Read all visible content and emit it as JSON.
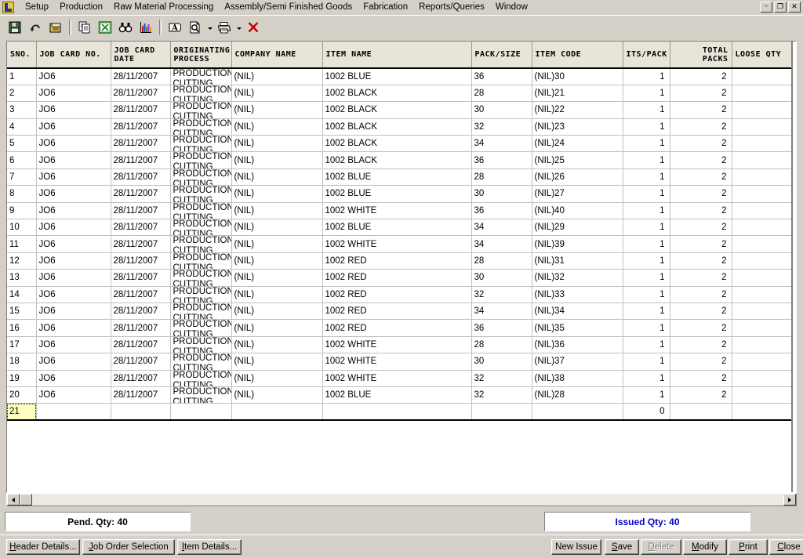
{
  "window": {
    "app_icon": "app-logo-icon",
    "controls": [
      {
        "name": "minimize-button",
        "glyph": "–"
      },
      {
        "name": "restore-button",
        "glyph": "❐"
      },
      {
        "name": "close-button",
        "glyph": "✕"
      }
    ]
  },
  "menubar": {
    "items": [
      {
        "label": "Setup"
      },
      {
        "label": "Production"
      },
      {
        "label": "Raw Material Processing"
      },
      {
        "label": "Assembly/Semi Finished Goods"
      },
      {
        "label": "Fabrication"
      },
      {
        "label": "Reports/Queries"
      },
      {
        "label": "Window"
      }
    ]
  },
  "toolbar": {
    "buttons": [
      {
        "name": "save-icon",
        "title": "Save"
      },
      {
        "name": "undo-icon",
        "title": "Undo"
      },
      {
        "name": "open-folder-icon",
        "title": "Open"
      },
      {
        "name": "copy-icon",
        "title": "Copy"
      },
      {
        "name": "export-excel-icon",
        "title": "Export to Excel"
      },
      {
        "name": "find-binoculars-icon",
        "title": "Find"
      },
      {
        "name": "chart-icon",
        "title": "Chart"
      },
      {
        "name": "text-format-icon",
        "title": "Font"
      },
      {
        "name": "print-preview-icon",
        "title": "Print Preview"
      },
      {
        "name": "printer-icon",
        "title": "Print"
      },
      {
        "name": "close-red-x-icon",
        "title": "Close"
      }
    ]
  },
  "grid": {
    "columns": [
      {
        "key": "sno",
        "label": "SNO.",
        "align": "left"
      },
      {
        "key": "job_card_no",
        "label": "JOB CARD NO.",
        "align": "left"
      },
      {
        "key": "job_card_date",
        "label": "JOB CARD DATE",
        "align": "left"
      },
      {
        "key": "originating_process",
        "label": "ORIGINATING PROCESS",
        "align": "left"
      },
      {
        "key": "company_name",
        "label": "COMPANY NAME",
        "align": "left"
      },
      {
        "key": "item_name",
        "label": "ITEM NAME",
        "align": "left"
      },
      {
        "key": "pack_size",
        "label": "PACK/SIZE",
        "align": "left"
      },
      {
        "key": "item_code",
        "label": "ITEM CODE",
        "align": "left"
      },
      {
        "key": "its_pack",
        "label": "ITS/PACK",
        "align": "right"
      },
      {
        "key": "total_packs",
        "label": "TOTAL PACKS",
        "align": "right"
      },
      {
        "key": "loose_qty",
        "label": "LOOSE QTY",
        "align": "left"
      }
    ],
    "rows": [
      {
        "sno": "1",
        "job_card_no": "JO6",
        "job_card_date": "28/11/2007",
        "originating_process": "PRODUCTION CUTTING",
        "company_name": "(NIL)",
        "item_name": "1002 BLUE",
        "pack_size": "36",
        "item_code": "(NIL)30",
        "its_pack": "1",
        "total_packs": "2",
        "loose_qty": ""
      },
      {
        "sno": "2",
        "job_card_no": "JO6",
        "job_card_date": "28/11/2007",
        "originating_process": "PRODUCTION CUTTING",
        "company_name": "(NIL)",
        "item_name": "1002 BLACK",
        "pack_size": "28",
        "item_code": "(NIL)21",
        "its_pack": "1",
        "total_packs": "2",
        "loose_qty": ""
      },
      {
        "sno": "3",
        "job_card_no": "JO6",
        "job_card_date": "28/11/2007",
        "originating_process": "PRODUCTION CUTTING",
        "company_name": "(NIL)",
        "item_name": "1002 BLACK",
        "pack_size": "30",
        "item_code": "(NIL)22",
        "its_pack": "1",
        "total_packs": "2",
        "loose_qty": ""
      },
      {
        "sno": "4",
        "job_card_no": "JO6",
        "job_card_date": "28/11/2007",
        "originating_process": "PRODUCTION CUTTING",
        "company_name": "(NIL)",
        "item_name": "1002 BLACK",
        "pack_size": "32",
        "item_code": "(NIL)23",
        "its_pack": "1",
        "total_packs": "2",
        "loose_qty": ""
      },
      {
        "sno": "5",
        "job_card_no": "JO6",
        "job_card_date": "28/11/2007",
        "originating_process": "PRODUCTION CUTTING",
        "company_name": "(NIL)",
        "item_name": "1002 BLACK",
        "pack_size": "34",
        "item_code": "(NIL)24",
        "its_pack": "1",
        "total_packs": "2",
        "loose_qty": ""
      },
      {
        "sno": "6",
        "job_card_no": "JO6",
        "job_card_date": "28/11/2007",
        "originating_process": "PRODUCTION CUTTING",
        "company_name": "(NIL)",
        "item_name": "1002 BLACK",
        "pack_size": "36",
        "item_code": "(NIL)25",
        "its_pack": "1",
        "total_packs": "2",
        "loose_qty": ""
      },
      {
        "sno": "7",
        "job_card_no": "JO6",
        "job_card_date": "28/11/2007",
        "originating_process": "PRODUCTION CUTTING",
        "company_name": "(NIL)",
        "item_name": "1002 BLUE",
        "pack_size": "28",
        "item_code": "(NIL)26",
        "its_pack": "1",
        "total_packs": "2",
        "loose_qty": ""
      },
      {
        "sno": "8",
        "job_card_no": "JO6",
        "job_card_date": "28/11/2007",
        "originating_process": "PRODUCTION CUTTING",
        "company_name": "(NIL)",
        "item_name": "1002 BLUE",
        "pack_size": "30",
        "item_code": "(NIL)27",
        "its_pack": "1",
        "total_packs": "2",
        "loose_qty": ""
      },
      {
        "sno": "9",
        "job_card_no": "JO6",
        "job_card_date": "28/11/2007",
        "originating_process": "PRODUCTION CUTTING",
        "company_name": "(NIL)",
        "item_name": "1002 WHITE",
        "pack_size": "36",
        "item_code": "(NIL)40",
        "its_pack": "1",
        "total_packs": "2",
        "loose_qty": ""
      },
      {
        "sno": "10",
        "job_card_no": "JO6",
        "job_card_date": "28/11/2007",
        "originating_process": "PRODUCTION CUTTING",
        "company_name": "(NIL)",
        "item_name": "1002 BLUE",
        "pack_size": "34",
        "item_code": "(NIL)29",
        "its_pack": "1",
        "total_packs": "2",
        "loose_qty": ""
      },
      {
        "sno": "11",
        "job_card_no": "JO6",
        "job_card_date": "28/11/2007",
        "originating_process": "PRODUCTION CUTTING",
        "company_name": "(NIL)",
        "item_name": "1002 WHITE",
        "pack_size": "34",
        "item_code": "(NIL)39",
        "its_pack": "1",
        "total_packs": "2",
        "loose_qty": ""
      },
      {
        "sno": "12",
        "job_card_no": "JO6",
        "job_card_date": "28/11/2007",
        "originating_process": "PRODUCTION CUTTING",
        "company_name": "(NIL)",
        "item_name": "1002 RED",
        "pack_size": "28",
        "item_code": "(NIL)31",
        "its_pack": "1",
        "total_packs": "2",
        "loose_qty": ""
      },
      {
        "sno": "13",
        "job_card_no": "JO6",
        "job_card_date": "28/11/2007",
        "originating_process": "PRODUCTION CUTTING",
        "company_name": "(NIL)",
        "item_name": "1002 RED",
        "pack_size": "30",
        "item_code": "(NIL)32",
        "its_pack": "1",
        "total_packs": "2",
        "loose_qty": ""
      },
      {
        "sno": "14",
        "job_card_no": "JO6",
        "job_card_date": "28/11/2007",
        "originating_process": "PRODUCTION CUTTING",
        "company_name": "(NIL)",
        "item_name": "1002 RED",
        "pack_size": "32",
        "item_code": "(NIL)33",
        "its_pack": "1",
        "total_packs": "2",
        "loose_qty": ""
      },
      {
        "sno": "15",
        "job_card_no": "JO6",
        "job_card_date": "28/11/2007",
        "originating_process": "PRODUCTION CUTTING",
        "company_name": "(NIL)",
        "item_name": "1002 RED",
        "pack_size": "34",
        "item_code": "(NIL)34",
        "its_pack": "1",
        "total_packs": "2",
        "loose_qty": ""
      },
      {
        "sno": "16",
        "job_card_no": "JO6",
        "job_card_date": "28/11/2007",
        "originating_process": "PRODUCTION CUTTING",
        "company_name": "(NIL)",
        "item_name": "1002 RED",
        "pack_size": "36",
        "item_code": "(NIL)35",
        "its_pack": "1",
        "total_packs": "2",
        "loose_qty": ""
      },
      {
        "sno": "17",
        "job_card_no": "JO6",
        "job_card_date": "28/11/2007",
        "originating_process": "PRODUCTION CUTTING",
        "company_name": "(NIL)",
        "item_name": "1002 WHITE",
        "pack_size": "28",
        "item_code": "(NIL)36",
        "its_pack": "1",
        "total_packs": "2",
        "loose_qty": ""
      },
      {
        "sno": "18",
        "job_card_no": "JO6",
        "job_card_date": "28/11/2007",
        "originating_process": "PRODUCTION CUTTING",
        "company_name": "(NIL)",
        "item_name": "1002 WHITE",
        "pack_size": "30",
        "item_code": "(NIL)37",
        "its_pack": "1",
        "total_packs": "2",
        "loose_qty": ""
      },
      {
        "sno": "19",
        "job_card_no": "JO6",
        "job_card_date": "28/11/2007",
        "originating_process": "PRODUCTION CUTTING",
        "company_name": "(NIL)",
        "item_name": "1002 WHITE",
        "pack_size": "32",
        "item_code": "(NIL)38",
        "its_pack": "1",
        "total_packs": "2",
        "loose_qty": ""
      },
      {
        "sno": "20",
        "job_card_no": "JO6",
        "job_card_date": "28/11/2007",
        "originating_process": "PRODUCTION CUTTING",
        "company_name": "(NIL)",
        "item_name": "1002 BLUE",
        "pack_size": "32",
        "item_code": "(NIL)28",
        "its_pack": "1",
        "total_packs": "2",
        "loose_qty": ""
      },
      {
        "sno": "21",
        "job_card_no": "",
        "job_card_date": "",
        "originating_process": "",
        "company_name": "",
        "item_name": "",
        "pack_size": "",
        "item_code": "",
        "its_pack": "0",
        "total_packs": "",
        "loose_qty": "",
        "focused": true
      }
    ]
  },
  "status": {
    "pending_qty": "Pend. Qty: 40",
    "issued_qty": "Issued Qty: 40",
    "issued_color": "#0000cc"
  },
  "buttons": {
    "left": [
      {
        "name": "header-details-button",
        "accel": "H",
        "rest": "eader Details...",
        "enabled": true
      },
      {
        "name": "job-order-selection-button",
        "accel": "J",
        "rest": "ob Order Selection",
        "enabled": true
      },
      {
        "name": "item-details-button",
        "accel": "I",
        "rest": "tem Details...",
        "enabled": true
      }
    ],
    "right": [
      {
        "name": "new-issue-button",
        "accel": "",
        "rest": "New Issue",
        "enabled": true
      },
      {
        "name": "save-button",
        "accel": "S",
        "rest": "ave",
        "enabled": true
      },
      {
        "name": "delete-button",
        "accel": "D",
        "rest": "elete",
        "enabled": false
      },
      {
        "name": "modify-button",
        "accel": "M",
        "rest": "odify",
        "enabled": true
      },
      {
        "name": "print-button",
        "accel": "P",
        "rest": "rint",
        "enabled": true
      },
      {
        "name": "close-button",
        "accel": "C",
        "rest": "lose",
        "enabled": true
      }
    ]
  }
}
